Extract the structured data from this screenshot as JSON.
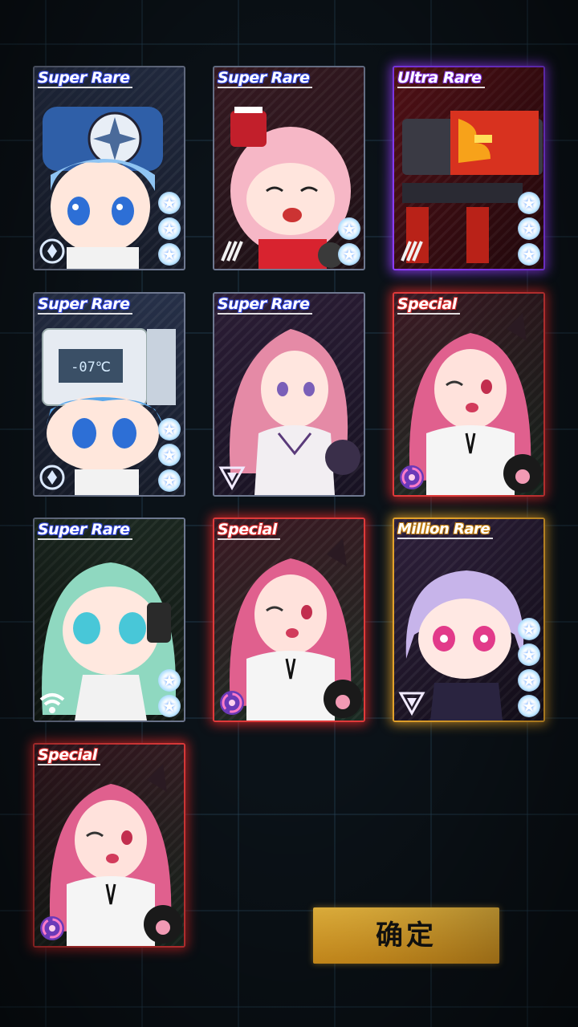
{
  "results": {
    "cards": [
      {
        "rarity_label": "Super Rare",
        "tier": "sr",
        "class_icon": "shield-diamond-icon",
        "stars": 3,
        "character": "chibi-blue-hair-helmet-fan"
      },
      {
        "rarity_label": "Super Rare",
        "tier": "sr",
        "class_icon": "slash-claw-icon",
        "stars": 2,
        "character": "chibi-pink-hair-top-hat"
      },
      {
        "rarity_label": "Ultra Rare",
        "tier": "ur",
        "class_icon": "slash-claw-icon",
        "stars": 3,
        "character": "red-mecha-cannon"
      },
      {
        "rarity_label": "Super Rare",
        "tier": "sr",
        "class_icon": "shield-diamond-icon",
        "stars": 3,
        "character": "chibi-blue-hair-freezer",
        "device_readout": "-07℃"
      },
      {
        "rarity_label": "Super Rare",
        "tier": "sr",
        "class_icon": "inverted-triangle-icon",
        "stars": 0,
        "character": "pink-hair-girl-white-dress"
      },
      {
        "rarity_label": "Special",
        "tier": "sp",
        "class_icon": "swirl-orb-icon",
        "stars": 0,
        "character": "pink-hair-cat-ears-paw"
      },
      {
        "rarity_label": "Super Rare",
        "tier": "sr",
        "class_icon": "wifi-signal-icon",
        "stars": 2,
        "character": "chibi-green-hair-headphones"
      },
      {
        "rarity_label": "Special",
        "tier": "sp",
        "class_icon": "swirl-orb-icon",
        "stars": 0,
        "character": "pink-hair-cat-ears-paw"
      },
      {
        "rarity_label": "Million Rare",
        "tier": "mr",
        "class_icon": "inverted-triangle-icon",
        "stars": 4,
        "character": "chibi-lavender-hair"
      },
      {
        "rarity_label": "Special",
        "tier": "sp",
        "class_icon": "swirl-orb-icon",
        "stars": 0,
        "character": "pink-hair-cat-ears-paw"
      }
    ]
  },
  "confirm": {
    "label": "确定"
  },
  "colors": {
    "background": "#0b1218",
    "super_rare_border": "#6e7890",
    "ultra_rare_glow": "#8b3cff",
    "special_glow": "#e03a3a",
    "million_rare_glow": "#e3a22a",
    "confirm_button": "#f5b52a"
  }
}
